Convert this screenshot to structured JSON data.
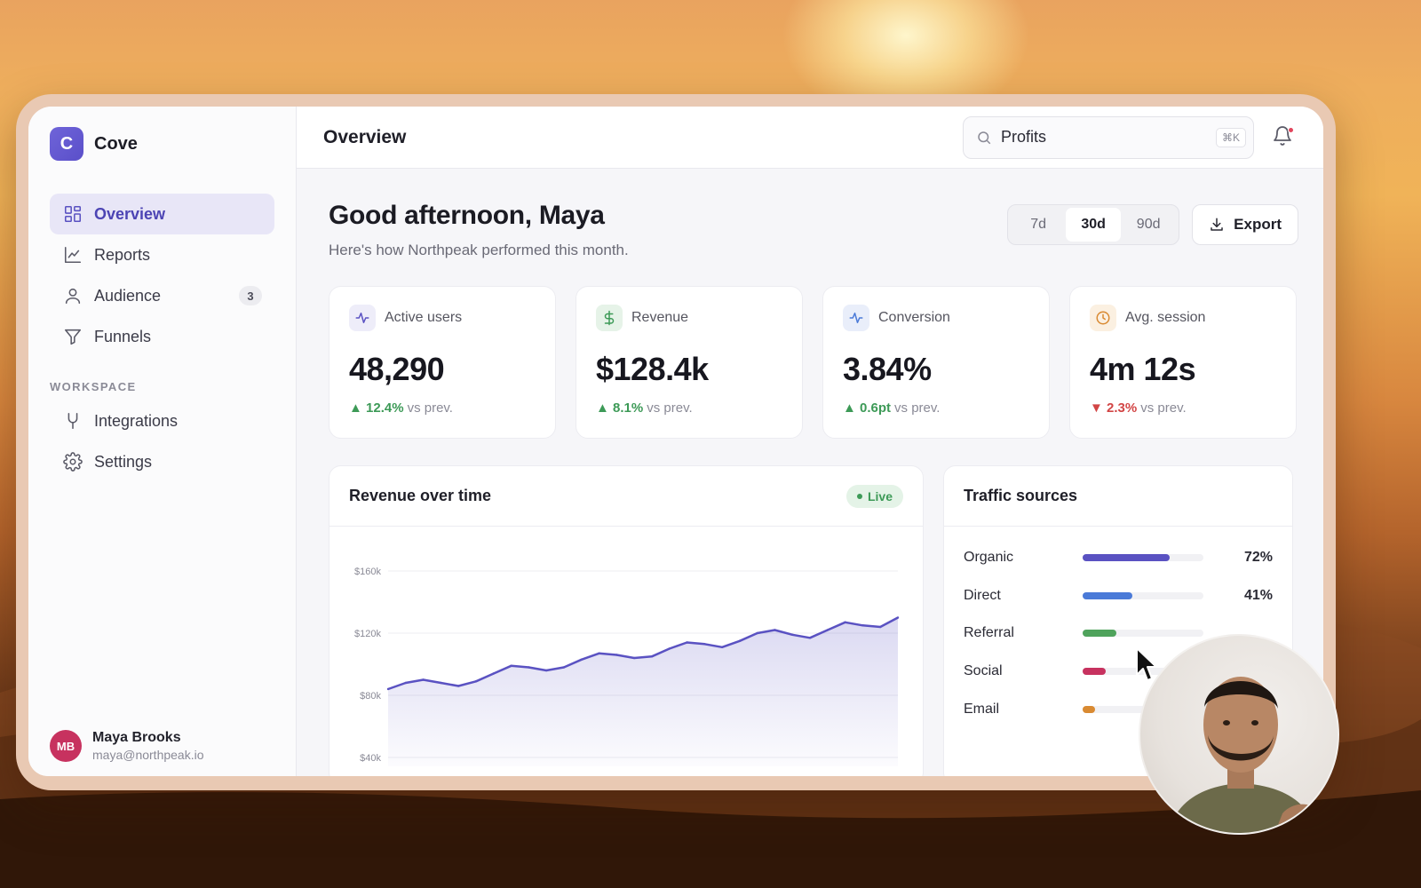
{
  "brand": {
    "logo_letter": "C",
    "name": "Cove",
    "accent": "#5a52c2"
  },
  "sidebar": {
    "items": [
      {
        "label": "Overview",
        "icon": "grid-icon",
        "active": true
      },
      {
        "label": "Reports",
        "icon": "line-chart-icon"
      },
      {
        "label": "Audience",
        "icon": "user-icon",
        "badge": "3"
      },
      {
        "label": "Funnels",
        "icon": "filter-icon"
      }
    ],
    "workspace_label": "WORKSPACE",
    "workspace_items": [
      {
        "label": "Integrations",
        "icon": "fork-icon"
      },
      {
        "label": "Settings",
        "icon": "gear-icon"
      }
    ]
  },
  "user": {
    "initials": "MB",
    "name": "Maya Brooks",
    "email": "maya@northpeak.io"
  },
  "topbar": {
    "title": "Overview",
    "search_value": "Profits",
    "search_shortcut": "⌘K"
  },
  "header": {
    "greeting": "Good afternoon, Maya",
    "subtitle": "Here's how Northpeak performed this month.",
    "ranges": [
      "7d",
      "30d",
      "90d"
    ],
    "selected_range": "30d",
    "export_label": "Export"
  },
  "stats": [
    {
      "label": "Active users",
      "value": "48,290",
      "arrow": "▲",
      "change": "12.4%",
      "suffix": "vs prev.",
      "direction": "up",
      "icon": "activity-icon"
    },
    {
      "label": "Revenue",
      "value": "$128.4k",
      "arrow": "▲",
      "change": "8.1%",
      "suffix": "vs prev.",
      "direction": "up",
      "icon": "dollar-icon"
    },
    {
      "label": "Conversion",
      "value": "3.84%",
      "arrow": "▲",
      "change": "0.6pt",
      "suffix": "vs prev.",
      "direction": "up",
      "icon": "activity-icon"
    },
    {
      "label": "Avg. session",
      "value": "4m 12s",
      "arrow": "▼",
      "change": "2.3%",
      "suffix": "vs prev.",
      "direction": "down",
      "icon": "clock-icon"
    }
  ],
  "revenue_panel": {
    "title": "Revenue over time",
    "live_label": "Live"
  },
  "chart_data": {
    "type": "area",
    "title": "Revenue over time",
    "ytick_labels": [
      "$160k",
      "$120k",
      "$80k",
      "$40k"
    ],
    "yticks": [
      160,
      120,
      80,
      40
    ],
    "ylim": [
      40,
      160
    ],
    "x": [
      1,
      2,
      3,
      4,
      5,
      6,
      7,
      8,
      9,
      10,
      11,
      12,
      13,
      14,
      15,
      16,
      17,
      18,
      19,
      20,
      21,
      22,
      23,
      24,
      25,
      26,
      27,
      28,
      29,
      30
    ],
    "values": [
      84,
      88,
      90,
      88,
      86,
      89,
      94,
      99,
      98,
      96,
      98,
      103,
      107,
      106,
      104,
      105,
      110,
      114,
      113,
      111,
      115,
      120,
      122,
      119,
      117,
      122,
      127,
      125,
      124,
      130
    ],
    "grid": true,
    "color": "#5a52c2"
  },
  "traffic": {
    "title": "Traffic sources",
    "rows": [
      {
        "name": "Organic",
        "pct": "72%",
        "value": 72,
        "color": "#5a52c2"
      },
      {
        "name": "Direct",
        "pct": "41%",
        "value": 41,
        "color": "#4a7ad8"
      },
      {
        "name": "Referral",
        "pct": "",
        "value": 28,
        "color": "#4fa35c"
      },
      {
        "name": "Social",
        "pct": "",
        "value": 19,
        "color": "#c7325f"
      },
      {
        "name": "Email",
        "pct": "",
        "value": 10,
        "color": "#d98a32"
      }
    ]
  }
}
